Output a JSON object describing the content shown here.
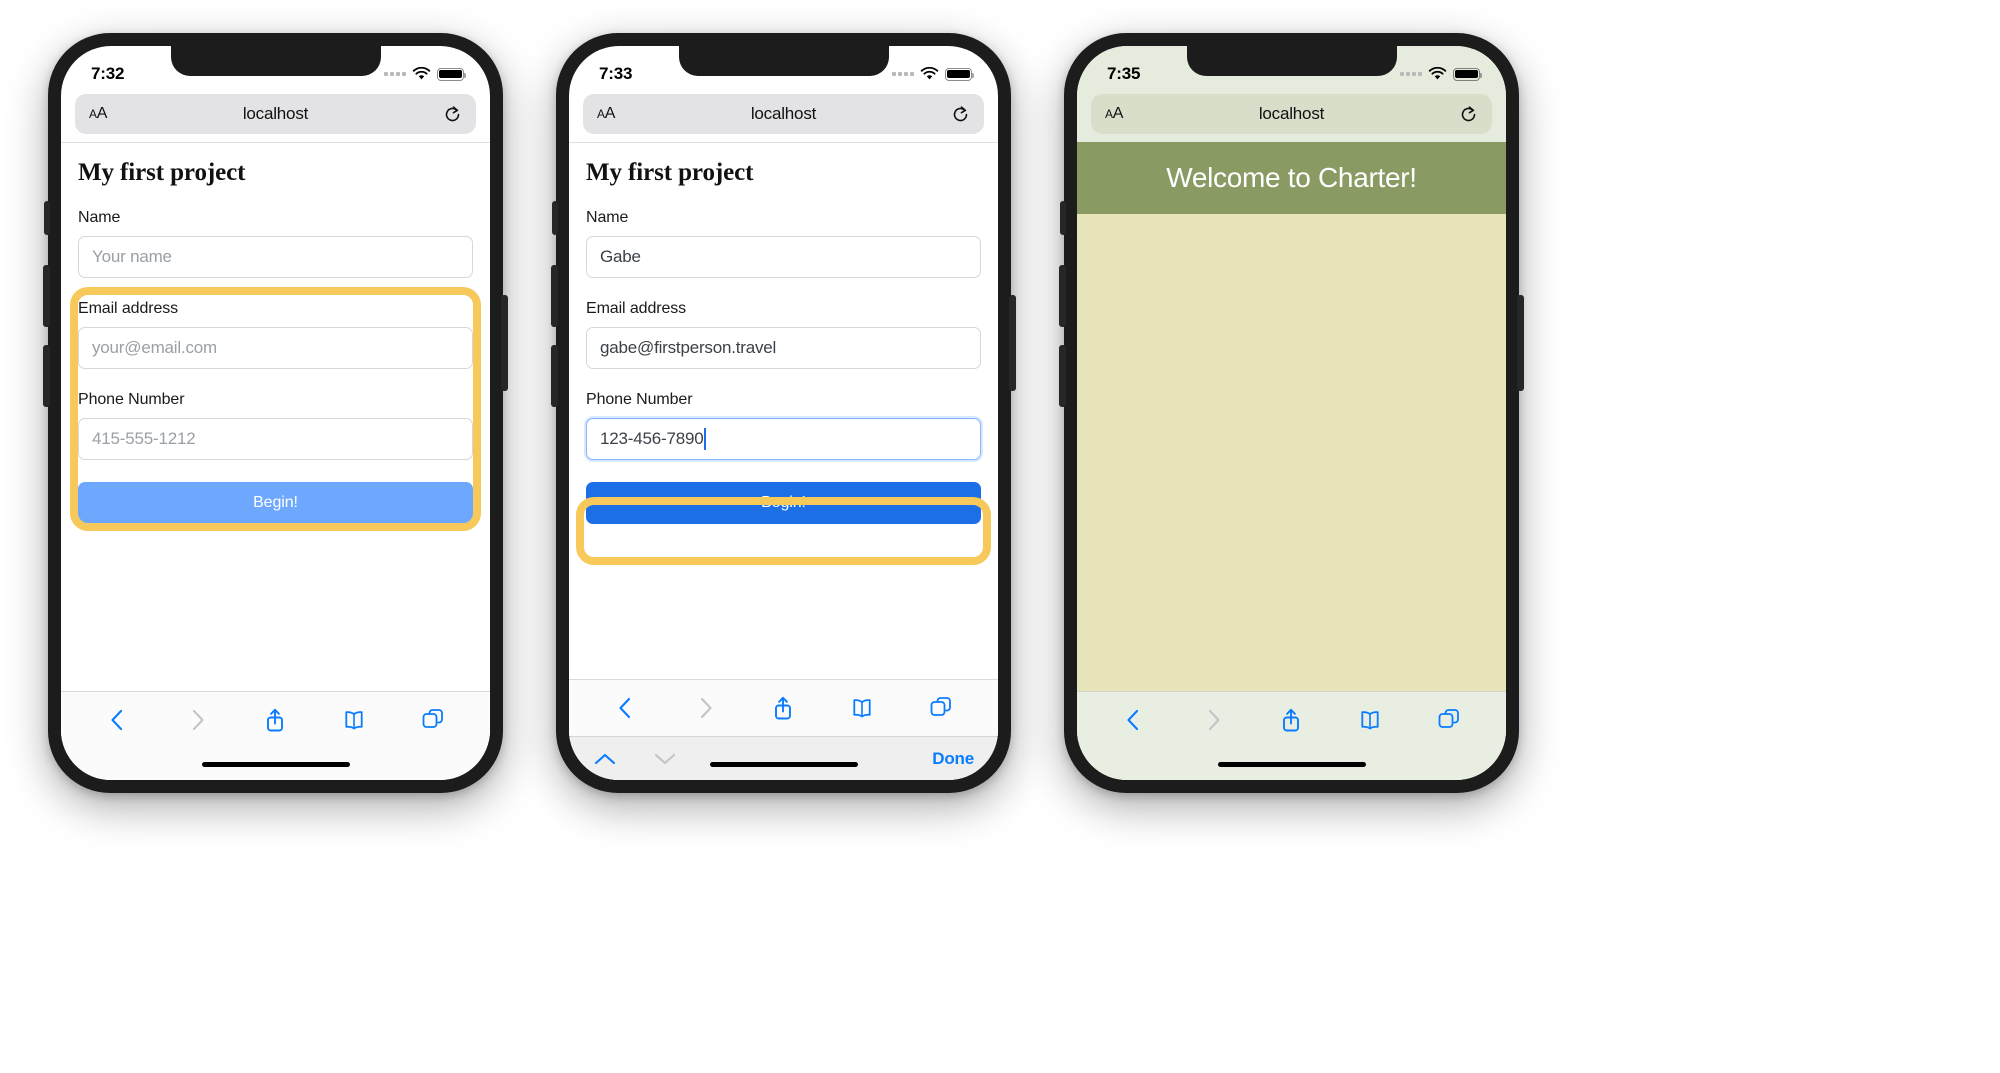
{
  "meta": {
    "description": "Three iPhone screenshots of a Safari web form on localhost"
  },
  "colors": {
    "highlight": "#f6c95a",
    "button_active": "#1d6fe8",
    "button_dim": "#6ea8fe",
    "safari_blue": "#0a7cff",
    "welcome_band": "#8a9a63",
    "welcome_body": "#e9e5ba",
    "chrome_green": "#e6ecdd"
  },
  "phones": [
    {
      "id": "phone-1",
      "status": {
        "time": "7:32",
        "wifi_icon": "wifi-icon",
        "battery_icon": "battery-icon",
        "signal_icon": "signal-dots-icon"
      },
      "browser": {
        "text_size_label": "AA",
        "text_size_icon": "text-size-icon",
        "host": "localhost",
        "reload_icon": "reload-icon"
      },
      "page": {
        "title": "My first project",
        "fields": [
          {
            "label": "Name",
            "value": "",
            "placeholder": "Your name",
            "focused": false
          },
          {
            "label": "Email address",
            "value": "",
            "placeholder": "your@email.com",
            "focused": false
          },
          {
            "label": "Phone Number",
            "value": "",
            "placeholder": "415-555-1212",
            "focused": false
          }
        ],
        "submit_label": "Begin!",
        "submit_state": "dim"
      },
      "highlight": {
        "target": "form-fields",
        "visible": true
      },
      "toolbar": {
        "back_icon": "chevron-left-icon",
        "forward_icon": "chevron-right-icon",
        "share_icon": "share-icon",
        "bookmarks_icon": "book-icon",
        "tabs_icon": "tabs-icon",
        "back_enabled": true,
        "forward_enabled": false
      },
      "accessory": {
        "visible": false
      }
    },
    {
      "id": "phone-2",
      "status": {
        "time": "7:33",
        "wifi_icon": "wifi-icon",
        "battery_icon": "battery-icon",
        "signal_icon": "signal-dots-icon"
      },
      "browser": {
        "text_size_label": "AA",
        "text_size_icon": "text-size-icon",
        "host": "localhost",
        "reload_icon": "reload-icon"
      },
      "page": {
        "title": "My first project",
        "fields": [
          {
            "label": "Name",
            "value": "Gabe",
            "placeholder": "Your name",
            "focused": false
          },
          {
            "label": "Email address",
            "value": "gabe@firstperson.travel",
            "placeholder": "your@email.com",
            "focused": false
          },
          {
            "label": "Phone Number",
            "value": "123-456-7890",
            "placeholder": "415-555-1212",
            "focused": true
          }
        ],
        "submit_label": "Begin!",
        "submit_state": "active"
      },
      "highlight": {
        "target": "submit-button",
        "visible": true
      },
      "toolbar": {
        "back_icon": "chevron-left-icon",
        "forward_icon": "chevron-right-icon",
        "share_icon": "share-icon",
        "bookmarks_icon": "book-icon",
        "tabs_icon": "tabs-icon",
        "back_enabled": true,
        "forward_enabled": false
      },
      "accessory": {
        "visible": true,
        "prev_icon": "chevron-up-icon",
        "next_icon": "chevron-down-icon",
        "prev_enabled": true,
        "next_enabled": false,
        "done_label": "Done"
      }
    },
    {
      "id": "phone-3",
      "status": {
        "time": "7:35",
        "wifi_icon": "wifi-icon",
        "battery_icon": "battery-icon",
        "signal_icon": "signal-dots-icon"
      },
      "browser": {
        "text_size_label": "AA",
        "text_size_icon": "text-size-icon",
        "host": "localhost",
        "reload_icon": "reload-icon"
      },
      "page": {
        "welcome_heading": "Welcome to Charter!"
      },
      "highlight": {
        "target": "none",
        "visible": false
      },
      "toolbar": {
        "back_icon": "chevron-left-icon",
        "forward_icon": "chevron-right-icon",
        "share_icon": "share-icon",
        "bookmarks_icon": "book-icon",
        "tabs_icon": "tabs-icon",
        "back_enabled": true,
        "forward_enabled": false
      },
      "accessory": {
        "visible": false
      }
    }
  ]
}
